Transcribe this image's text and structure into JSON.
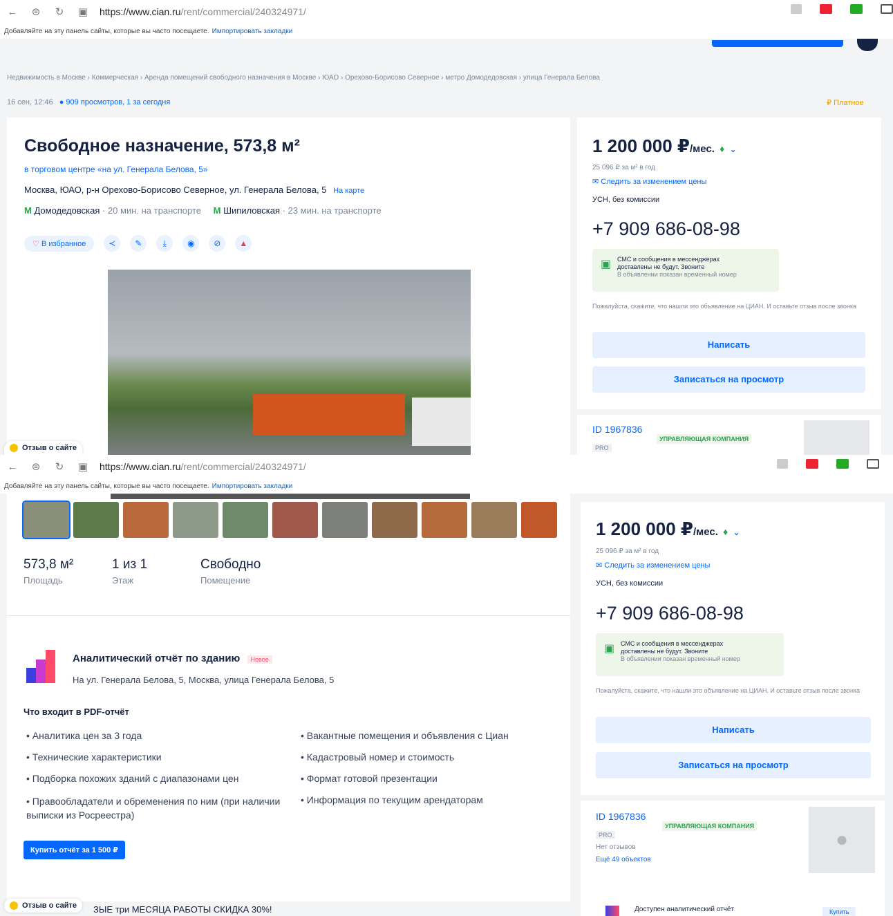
{
  "browser": {
    "url_host": "https://www.cian.ru",
    "url_path": "/rent/commercial/240324971/",
    "bookmarks_text": "Добавляйте на эту панель сайты, которые вы часто посещаете.",
    "bookmarks_link": "Импортировать закладки"
  },
  "breadcrumbs": [
    "Недвижимость в Москве",
    "Коммерческая",
    "Аренда помещений свободного назначения в Москве",
    "ЮАО",
    "Орехово-Борисово Северное",
    "метро Домодедовская",
    "улица Генерала Белова"
  ],
  "meta": {
    "date": "16 сен, 12:46",
    "views": "909 просмотров, 1 за сегодня",
    "paid": "Платное"
  },
  "listing": {
    "title": "Свободное назначение, 573,8 м²",
    "center_link": "в торговом центре «на ул. Генерала Белова, 5»",
    "address": "Москва, ЮАО, р-н Орехово-Борисово Северное, ул. Генерала Белова, 5",
    "map_link": "На карте",
    "metro1": "Домодедовская",
    "metro1_time": "· 20 мин. на транспорте",
    "metro2": "Шипиловская",
    "metro2_time": "· 23 мин. на транспорте",
    "favorite": "В избранное"
  },
  "stats": [
    {
      "value": "573,8 м²",
      "label": "Площадь"
    },
    {
      "value": "1 из 1",
      "label": "Этаж"
    },
    {
      "value": "Свободно",
      "label": "Помещение"
    }
  ],
  "report": {
    "title": "Аналитический отчёт по зданию",
    "badge": "Новое",
    "address": "На ул. Генерала Белова, 5, Москва, улица Генерала Белова, 5",
    "pdf_heading": "Что входит в PDF-отчёт",
    "items_left": [
      "Аналитика цен за 3 года",
      "Технические характеристики",
      "Подборка похожих зданий с диапазонами цен",
      "Правообладатели и обременения по ним (при наличии выписки из Росреестра)"
    ],
    "items_right": [
      "Вакантные помещения и объявления с Циан",
      "Кадастровый номер и стоимость",
      "Формат готовой презентации",
      "Информация по текущим арендаторам"
    ],
    "buy_button": "Купить отчёт за 1 500 ₽"
  },
  "sidebar": {
    "price": "1 200 000 ₽",
    "per": "/мес.",
    "per_meter": "25 096 ₽ за м² в год",
    "follow": "Следить за изменением цены",
    "tax": "УСН, без комиссии",
    "phone": "+7 909 686-08-98",
    "sms_line1": "СМС и сообщения в мессенджерах",
    "sms_line2": "доставлены не будут. Звоните",
    "sms_line3": "В объявлении показан временный номер",
    "notice": "Пожалуйста, скажите, что нашли это объявление на ЦИАН. И оставьте отзыв после звонка",
    "write_button": "Написать",
    "view_button": "Записаться на просмотр",
    "agent_id": "ID 1967836",
    "agent_type": "УПРАВЛЯЮЩАЯ КОМПАНИЯ",
    "pro": "PRO",
    "reviews": "Нет отзывов",
    "more": "Ещё 49 объектов",
    "analytics_teaser": "Доступен аналитический отчёт",
    "analytics_btn": "Купить"
  },
  "bottom_banner": "ЗЫЕ три МЕСЯЦА РАБОТЫ СКИДКА 30%!",
  "feedback": "Отзыв о сайте",
  "colors": {
    "accent": "#0468ff",
    "text": "#152242",
    "metro": "#2aa44e"
  }
}
